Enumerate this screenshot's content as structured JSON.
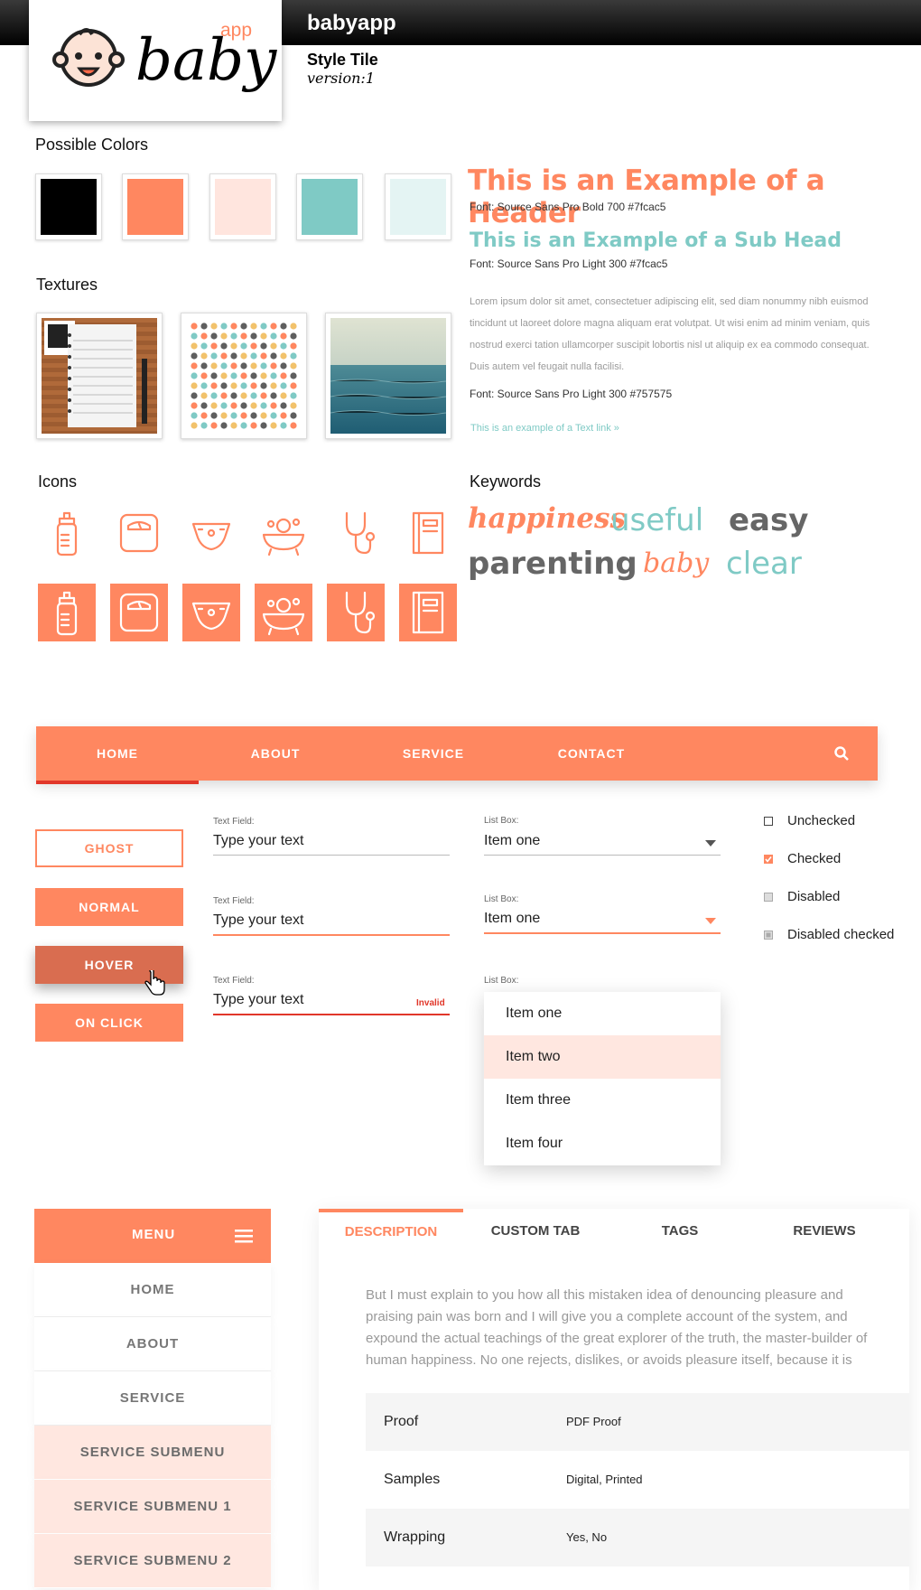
{
  "header": {
    "brand": "babyapp",
    "title": "Style Tile",
    "version": "version:1"
  },
  "logo": {
    "word": "baby",
    "sub": "app"
  },
  "colors": {
    "label": "Possible Colors",
    "swatches": [
      "#000000",
      "#ff8760",
      "#ffe5de",
      "#7fcac5",
      "#e4f4f3"
    ]
  },
  "typography": {
    "header": "This is an Example of a Header",
    "header_font": "Font: Source Sans Pro Bold 700 #7fcac5",
    "subhead": "This is an Example of a Sub Head",
    "subhead_font": "Font: Source Sans Pro Light 300 #7fcac5",
    "body": "Lorem ipsum dolor sit amet, consectetuer adipiscing elit, sed diam nonummy nibh euismod tincidunt ut laoreet dolore magna aliquam erat volutpat. Ut wisi enim ad minim veniam, quis nostrud exerci tation ullamcorper suscipit lobortis nisl ut aliquip ex ea commodo consequat. Duis autem vel feugait nulla facilisi.",
    "body_font": "Font: Source Sans Pro Light 300 #757575",
    "link": "This is an example of a Text link »"
  },
  "textures": {
    "label": "Textures",
    "items": [
      "notebook-texture",
      "dots-texture",
      "sea-texture"
    ]
  },
  "icons": {
    "label": "Icons",
    "items": [
      "baby-bottle-icon",
      "scale-icon",
      "diaper-icon",
      "bath-icon",
      "stethoscope-icon",
      "notebook-icon"
    ]
  },
  "keywords": {
    "label": "Keywords",
    "items": [
      "happiness",
      "useful",
      "easy",
      "parenting",
      "baby",
      "clear"
    ]
  },
  "nav": {
    "items": [
      "HOME",
      "ABOUT",
      "SERVICE",
      "CONTACT"
    ],
    "active": "HOME",
    "search_icon": "search-icon"
  },
  "buttons": {
    "ghost": "GHOST",
    "normal": "NORMAL",
    "hover": "HOVER",
    "onclick": "ON CLICK"
  },
  "fields": {
    "label": "Text Field:",
    "value": "Type your text",
    "invalid": "Invalid"
  },
  "listbox": {
    "label": "List Box:",
    "value": "Item one",
    "options": [
      "Item one",
      "Item two",
      "Item  three",
      "Item  four"
    ],
    "highlighted": "Item two"
  },
  "checkboxes": {
    "unchecked": "Unchecked",
    "checked": "Checked",
    "disabled": "Disabled",
    "disabled_checked": "Disabled checked"
  },
  "menu": {
    "title": "MENU",
    "items": [
      "HOME",
      "ABOUT",
      "SERVICE"
    ],
    "subitems": [
      "SERVICE SUBMENU",
      "SERVICE SUBMENU 1",
      "SERVICE SUBMENU 2"
    ]
  },
  "tabs": {
    "items": [
      "DESCRIPTION",
      "CUSTOM TAB",
      "TAGS",
      "REVIEWS"
    ],
    "active": "DESCRIPTION",
    "description": "But I must explain to you how all this mistaken idea of denouncing pleasure and praising pain was born and I will give you a complete account of the system, and expound the actual teachings of the great explorer of the truth, the master-builder of human happiness. No one rejects, dislikes, or avoids pleasure itself, because it is",
    "table": [
      {
        "key": "Proof",
        "value": "PDF Proof"
      },
      {
        "key": "Samples",
        "value": "Digital, Printed"
      },
      {
        "key": "Wrapping",
        "value": "Yes, No"
      }
    ]
  }
}
